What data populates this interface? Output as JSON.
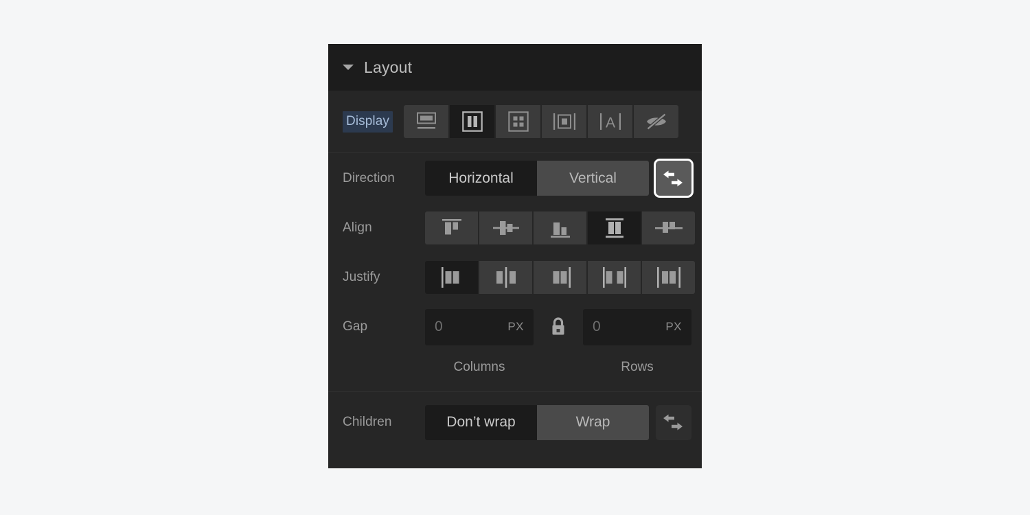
{
  "panel": {
    "title": "Layout",
    "collapse_icon": "caret-down-icon"
  },
  "display": {
    "label": "Display",
    "label_selected": true,
    "options": [
      {
        "name": "block",
        "icon": "display-block-icon",
        "active": false
      },
      {
        "name": "flex",
        "icon": "display-flex-icon",
        "active": true
      },
      {
        "name": "grid",
        "icon": "display-grid-icon",
        "active": false
      },
      {
        "name": "inline-block",
        "icon": "display-inline-block-icon",
        "active": false
      },
      {
        "name": "inline",
        "icon": "display-inline-icon",
        "active": false
      },
      {
        "name": "none",
        "icon": "display-none-eye-icon",
        "active": false
      }
    ]
  },
  "direction": {
    "label": "Direction",
    "options": [
      {
        "label": "Horizontal",
        "active": true
      },
      {
        "label": "Vertical",
        "active": false
      }
    ],
    "reverse": {
      "icon": "direction-reverse-icon",
      "active": true,
      "focused": true
    }
  },
  "align": {
    "label": "Align",
    "options": [
      {
        "name": "align-start",
        "icon": "align-start-icon",
        "active": false
      },
      {
        "name": "align-center",
        "icon": "align-center-icon",
        "active": false
      },
      {
        "name": "align-end",
        "icon": "align-end-icon",
        "active": false
      },
      {
        "name": "align-stretch",
        "icon": "align-stretch-icon",
        "active": true
      },
      {
        "name": "align-baseline",
        "icon": "align-baseline-icon",
        "active": false
      }
    ]
  },
  "justify": {
    "label": "Justify",
    "options": [
      {
        "name": "justify-start",
        "icon": "justify-start-icon",
        "active": true
      },
      {
        "name": "justify-center",
        "icon": "justify-center-icon",
        "active": false
      },
      {
        "name": "justify-end",
        "icon": "justify-end-icon",
        "active": false
      },
      {
        "name": "justify-space-between",
        "icon": "justify-space-between-icon",
        "active": false
      },
      {
        "name": "justify-space-around",
        "icon": "justify-space-around-icon",
        "active": false
      }
    ]
  },
  "gap": {
    "label": "Gap",
    "columns": {
      "value": "",
      "placeholder": "0",
      "unit": "PX",
      "sublabel": "Columns"
    },
    "rows": {
      "value": "",
      "placeholder": "0",
      "unit": "PX",
      "sublabel": "Rows"
    },
    "lock": {
      "icon": "lock-closed-icon",
      "locked": true
    }
  },
  "children": {
    "label": "Children",
    "options": [
      {
        "label": "Don’t wrap",
        "active": true
      },
      {
        "label": "Wrap",
        "active": false
      }
    ],
    "reverse": {
      "icon": "children-reverse-icon",
      "active": false,
      "focused": false
    }
  },
  "colors": {
    "panel_bg": "#262626",
    "header_bg": "#1c1c1c",
    "cell_bg": "#3b3b3b",
    "cell_active_bg": "#1b1b1b",
    "text": "#9b9b9b",
    "icon": "#8f8f8f",
    "selection_bg": "#2c3a4f",
    "selection_text": "#a7bdd9",
    "focus_ring": "#ffffff",
    "page_bg": "#f5f6f7"
  }
}
